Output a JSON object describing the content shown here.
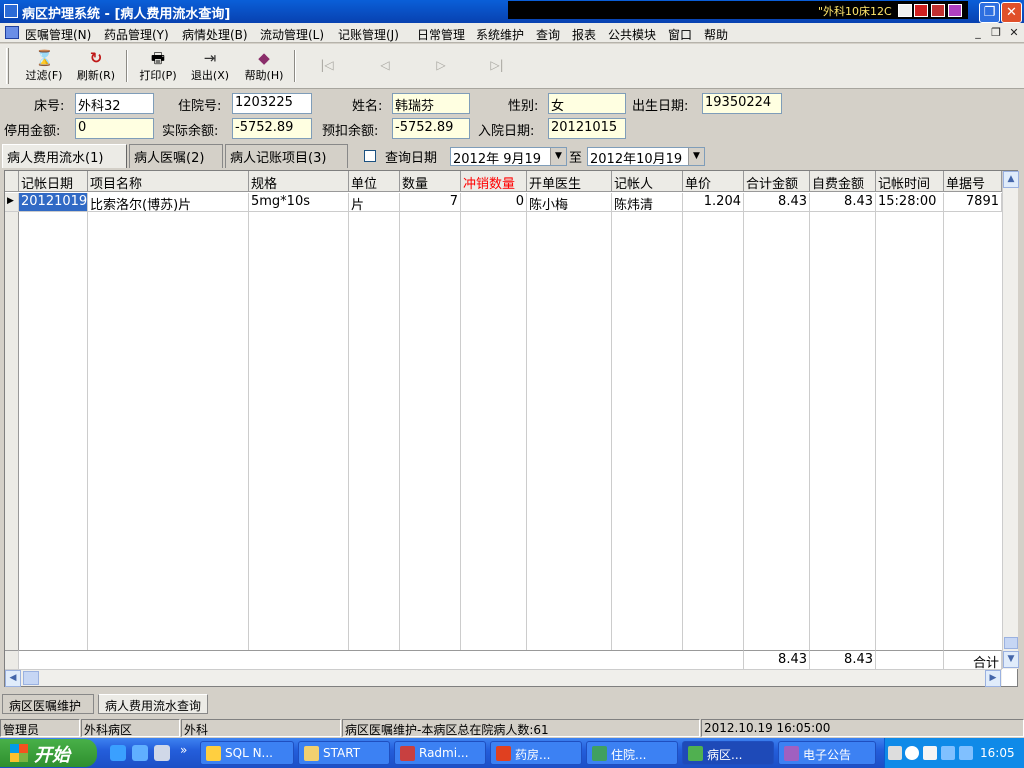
{
  "window": {
    "title": "病区护理系统 - [病人费用流水查询]",
    "tray_text": "\"外科10床12C"
  },
  "menu": {
    "items": [
      "医嘱管理(N)",
      "药品管理(Y)",
      "病情处理(B)",
      "流动管理(L)",
      "记账管理(J)",
      "日常管理",
      "系统维护",
      "查询",
      "报表",
      "公共模块",
      "窗口",
      "帮助"
    ]
  },
  "toolbar": {
    "filter": "过滤(F)",
    "refresh": "刷新(R)",
    "print": "打印(P)",
    "exit": "退出(X)",
    "help": "帮助(H)"
  },
  "patient": {
    "bed_label": "床号:",
    "bed": "外科32",
    "admission_no_label": "住院号:",
    "admission_no": "1203225",
    "name_label": "姓名:",
    "name": "韩瑞芬",
    "sex_label": "性别:",
    "sex": "女",
    "birth_label": "出生日期:",
    "birth": "19350224",
    "stop_amount_label": "停用金额:",
    "stop_amount": "0",
    "actual_balance_label": "实际余额:",
    "actual_balance": "-5752.89",
    "pre_balance_label": "预扣余额:",
    "pre_balance": "-5752.89",
    "admit_date_label": "入院日期:",
    "admit_date": "20121015"
  },
  "tabs": [
    "病人费用流水(1)",
    "病人医嘱(2)",
    "病人记账项目(3)"
  ],
  "query": {
    "checkbox_label": "查询日期",
    "date_from": "2012年 9月19",
    "to_label": "至",
    "date_to": "2012年10月19"
  },
  "table": {
    "columns": [
      "记帐日期",
      "项目名称",
      "规格",
      "单位",
      "数量",
      "冲销数量",
      "开单医生",
      "记帐人",
      "单价",
      "合计金额",
      "自费金额",
      "记帐时间",
      "单据号"
    ],
    "rows": [
      [
        "20121019",
        "比索洛尔(博苏)片",
        "5mg*10s",
        "片",
        "7",
        "0",
        "陈小梅",
        "陈炜清",
        "1.204",
        "8.43",
        "8.43",
        "15:28:00",
        "7891"
      ]
    ],
    "totals": {
      "total_amount": "8.43",
      "self_amount": "8.43",
      "label": "合计"
    },
    "accent_color": "#ff0000"
  },
  "subtabs": [
    "病区医嘱维护",
    "病人费用流水查询"
  ],
  "status": {
    "user": "管理员",
    "ward": "外科病区",
    "dept": "外科",
    "message": "病区医嘱维护-本病区总在院病人数:61",
    "datetime": "2012.10.19 16:05:00"
  },
  "taskbar": {
    "start": "开始",
    "tasks": [
      "SQL N...",
      "START",
      "Radmi...",
      "药房...",
      "住院...",
      "病区...",
      "电子公告"
    ],
    "clock": "16:05"
  }
}
